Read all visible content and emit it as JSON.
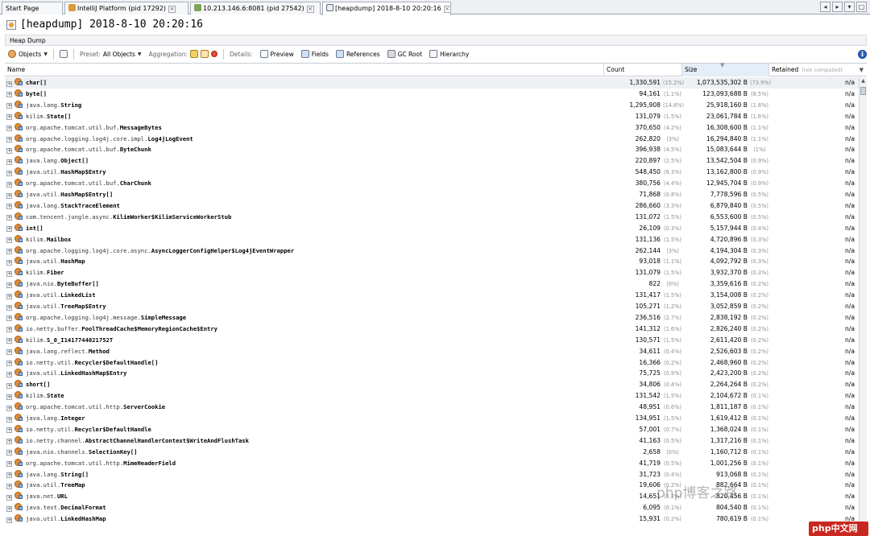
{
  "tabs": [
    {
      "label": "Start Page",
      "active": false,
      "icon": "start-page-icon"
    },
    {
      "label": "IntelliJ Platform (pid 17292)",
      "active": false,
      "icon": "java-process-icon"
    },
    {
      "label": "10.213.146.6:8081 (pid 27542)",
      "active": false,
      "icon": "remote-host-icon"
    },
    {
      "label": "[heapdump] 2018-8-10 20:20:16",
      "active": true,
      "icon": "heapdump-icon"
    }
  ],
  "window_buttons": [
    "◂",
    "▸",
    "▾",
    "□"
  ],
  "title": "[heapdump] 2018-8-10 20:20:16",
  "subtitle": "Heap Dump",
  "toolbar": {
    "objects": "Objects",
    "preset_label": "Preset:",
    "preset_value": "All Objects",
    "aggregation_label": "Aggregation:",
    "details_label": "Details:",
    "preview": "Preview",
    "fields": "Fields",
    "references": "References",
    "gc_root": "GC Root",
    "hierarchy": "Hierarchy"
  },
  "columns": {
    "name": "Name",
    "count": "Count",
    "size": "Size",
    "retained": "Retained",
    "retained_hint": "(not computed)"
  },
  "rows": [
    {
      "pkg": "",
      "cls": "char[]",
      "count": "1,330,591",
      "cpct": "(15.2%)",
      "size": "1,073,535,302 B",
      "spct": "(73.9%)",
      "retained": "n/a"
    },
    {
      "pkg": "",
      "cls": "byte[]",
      "count": "94,161",
      "cpct": "(1.1%)",
      "size": "123,093,688 B",
      "spct": "(8.5%)",
      "retained": "n/a"
    },
    {
      "pkg": "java.lang.",
      "cls": "String",
      "count": "1,295,908",
      "cpct": "(14.8%)",
      "size": "25,918,160 B",
      "spct": "(1.8%)",
      "retained": "n/a"
    },
    {
      "pkg": "kilim.",
      "cls": "State[]",
      "count": "131,079",
      "cpct": "(1.5%)",
      "size": "23,061,784 B",
      "spct": "(1.6%)",
      "retained": "n/a"
    },
    {
      "pkg": "org.apache.tomcat.util.buf.",
      "cls": "MessageBytes",
      "count": "370,650",
      "cpct": "(4.2%)",
      "size": "16,308,600 B",
      "spct": "(1.1%)",
      "retained": "n/a"
    },
    {
      "pkg": "org.apache.logging.log4j.core.impl.",
      "cls": "Log4jLogEvent",
      "count": "262,820",
      "cpct": "(3%)",
      "size": "16,294,840 B",
      "spct": "(1.1%)",
      "retained": "n/a"
    },
    {
      "pkg": "org.apache.tomcat.util.buf.",
      "cls": "ByteChunk",
      "count": "396,938",
      "cpct": "(4.5%)",
      "size": "15,083,644 B",
      "spct": "(1%)",
      "retained": "n/a"
    },
    {
      "pkg": "java.lang.",
      "cls": "Object[]",
      "count": "220,897",
      "cpct": "(2.5%)",
      "size": "13,542,504 B",
      "spct": "(0.9%)",
      "retained": "n/a"
    },
    {
      "pkg": "java.util.",
      "cls": "HashMap$Entry",
      "count": "548,450",
      "cpct": "(6.3%)",
      "size": "13,162,800 B",
      "spct": "(0.9%)",
      "retained": "n/a"
    },
    {
      "pkg": "org.apache.tomcat.util.buf.",
      "cls": "CharChunk",
      "count": "380,756",
      "cpct": "(4.4%)",
      "size": "12,945,704 B",
      "spct": "(0.9%)",
      "retained": "n/a"
    },
    {
      "pkg": "java.util.",
      "cls": "HashMap$Entry[]",
      "count": "71,868",
      "cpct": "(0.8%)",
      "size": "7,778,596 B",
      "spct": "(0.5%)",
      "retained": "n/a"
    },
    {
      "pkg": "java.lang.",
      "cls": "StackTraceElement",
      "count": "286,660",
      "cpct": "(3.3%)",
      "size": "6,879,840 B",
      "spct": "(0.5%)",
      "retained": "n/a"
    },
    {
      "pkg": "com.tencent.jungle.async.",
      "cls": "KilimWorker$KilimServiceWorkerStub",
      "count": "131,072",
      "cpct": "(1.5%)",
      "size": "6,553,600 B",
      "spct": "(0.5%)",
      "retained": "n/a"
    },
    {
      "pkg": "",
      "cls": "int[]",
      "count": "26,109",
      "cpct": "(0.3%)",
      "size": "5,157,944 B",
      "spct": "(0.4%)",
      "retained": "n/a"
    },
    {
      "pkg": "kilim.",
      "cls": "Mailbox",
      "count": "131,136",
      "cpct": "(1.5%)",
      "size": "4,720,896 B",
      "spct": "(0.3%)",
      "retained": "n/a"
    },
    {
      "pkg": "org.apache.logging.log4j.core.async.",
      "cls": "AsyncLoggerConfigHelper$Log4jEventWrapper",
      "count": "262,144",
      "cpct": "(3%)",
      "size": "4,194,304 B",
      "spct": "(0.3%)",
      "retained": "n/a"
    },
    {
      "pkg": "java.util.",
      "cls": "HashMap",
      "count": "93,018",
      "cpct": "(1.1%)",
      "size": "4,092,792 B",
      "spct": "(0.3%)",
      "retained": "n/a"
    },
    {
      "pkg": "kilim.",
      "cls": "Fiber",
      "count": "131,079",
      "cpct": "(1.5%)",
      "size": "3,932,370 B",
      "spct": "(0.3%)",
      "retained": "n/a"
    },
    {
      "pkg": "java.nio.",
      "cls": "ByteBuffer[]",
      "count": "822",
      "cpct": "(0%)",
      "size": "3,359,616 B",
      "spct": "(0.2%)",
      "retained": "n/a"
    },
    {
      "pkg": "java.util.",
      "cls": "LinkedList",
      "count": "131,417",
      "cpct": "(1.5%)",
      "size": "3,154,008 B",
      "spct": "(0.2%)",
      "retained": "n/a"
    },
    {
      "pkg": "java.util.",
      "cls": "TreeMap$Entry",
      "count": "105,271",
      "cpct": "(1.2%)",
      "size": "3,052,859 B",
      "spct": "(0.2%)",
      "retained": "n/a"
    },
    {
      "pkg": "org.apache.logging.log4j.message.",
      "cls": "SimpleMessage",
      "count": "236,516",
      "cpct": "(2.7%)",
      "size": "2,838,192 B",
      "spct": "(0.2%)",
      "retained": "n/a"
    },
    {
      "pkg": "io.netty.buffer.",
      "cls": "PoolThreadCache$MemoryRegionCache$Entry",
      "count": "141,312",
      "cpct": "(1.6%)",
      "size": "2,826,240 B",
      "spct": "(0.2%)",
      "retained": "n/a"
    },
    {
      "pkg": "kilim.",
      "cls": "S_0_I1417744021752T",
      "count": "130,571",
      "cpct": "(1.5%)",
      "size": "2,611,420 B",
      "spct": "(0.2%)",
      "retained": "n/a"
    },
    {
      "pkg": "java.lang.reflect.",
      "cls": "Method",
      "count": "34,611",
      "cpct": "(0.4%)",
      "size": "2,526,603 B",
      "spct": "(0.2%)",
      "retained": "n/a"
    },
    {
      "pkg": "io.netty.util.",
      "cls": "Recycler$DefaultHandle[]",
      "count": "16,366",
      "cpct": "(0.2%)",
      "size": "2,468,960 B",
      "spct": "(0.2%)",
      "retained": "n/a"
    },
    {
      "pkg": "java.util.",
      "cls": "LinkedHashMap$Entry",
      "count": "75,725",
      "cpct": "(0.9%)",
      "size": "2,423,200 B",
      "spct": "(0.2%)",
      "retained": "n/a"
    },
    {
      "pkg": "",
      "cls": "short[]",
      "count": "34,806",
      "cpct": "(0.4%)",
      "size": "2,264,264 B",
      "spct": "(0.2%)",
      "retained": "n/a"
    },
    {
      "pkg": "kilim.",
      "cls": "State",
      "count": "131,542",
      "cpct": "(1.5%)",
      "size": "2,104,672 B",
      "spct": "(0.1%)",
      "retained": "n/a"
    },
    {
      "pkg": "org.apache.tomcat.util.http.",
      "cls": "ServerCookie",
      "count": "48,951",
      "cpct": "(0.6%)",
      "size": "1,811,187 B",
      "spct": "(0.1%)",
      "retained": "n/a"
    },
    {
      "pkg": "java.lang.",
      "cls": "Integer",
      "count": "134,951",
      "cpct": "(1.5%)",
      "size": "1,619,412 B",
      "spct": "(0.1%)",
      "retained": "n/a"
    },
    {
      "pkg": "io.netty.util.",
      "cls": "Recycler$DefaultHandle",
      "count": "57,001",
      "cpct": "(0.7%)",
      "size": "1,368,024 B",
      "spct": "(0.1%)",
      "retained": "n/a"
    },
    {
      "pkg": "io.netty.channel.",
      "cls": "AbstractChannelHandlerContext$WriteAndFlushTask",
      "count": "41,163",
      "cpct": "(0.5%)",
      "size": "1,317,216 B",
      "spct": "(0.1%)",
      "retained": "n/a"
    },
    {
      "pkg": "java.nio.channels.",
      "cls": "SelectionKey[]",
      "count": "2,658",
      "cpct": "(0%)",
      "size": "1,160,712 B",
      "spct": "(0.1%)",
      "retained": "n/a"
    },
    {
      "pkg": "org.apache.tomcat.util.http.",
      "cls": "MimeHeaderField",
      "count": "41,719",
      "cpct": "(0.5%)",
      "size": "1,001,256 B",
      "spct": "(0.1%)",
      "retained": "n/a"
    },
    {
      "pkg": "java.lang.",
      "cls": "String[]",
      "count": "31,723",
      "cpct": "(0.4%)",
      "size": "913,068 B",
      "spct": "(0.1%)",
      "retained": "n/a"
    },
    {
      "pkg": "java.util.",
      "cls": "TreeMap",
      "count": "19,606",
      "cpct": "(0.2%)",
      "size": "882,664 B",
      "spct": "(0.1%)",
      "retained": "n/a"
    },
    {
      "pkg": "java.net.",
      "cls": "URL",
      "count": "14,651",
      "cpct": "(0.2%)",
      "size": "820,456 B",
      "spct": "(0.1%)",
      "retained": "n/a"
    },
    {
      "pkg": "java.text.",
      "cls": "DecimalFormat",
      "count": "6,095",
      "cpct": "(0.1%)",
      "size": "804,540 B",
      "spct": "(0.1%)",
      "retained": "n/a"
    },
    {
      "pkg": "java.util.",
      "cls": "LinkedHashMap",
      "count": "15,931",
      "cpct": "(0.2%)",
      "size": "780,619 B",
      "spct": "(0.1%)",
      "retained": "n/a"
    }
  ],
  "watermark_wechat": "php博客之路",
  "watermark_site": "php中文网"
}
